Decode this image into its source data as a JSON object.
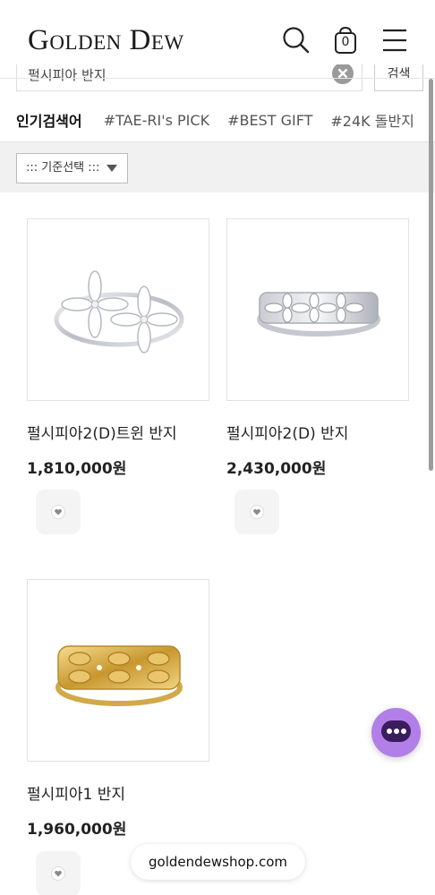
{
  "header": {
    "logo": "Golden Dew",
    "cart_count": "0",
    "icons": [
      "search-icon",
      "shopping-bag-icon",
      "hamburger-menu-icon"
    ]
  },
  "search": {
    "value": "펄시피아 반지",
    "button_label": "검색"
  },
  "keywords": {
    "title": "인기검색어",
    "items": [
      "#TAE-RI's PICK",
      "#BEST GIFT",
      "#24K 돌반지"
    ]
  },
  "sort": {
    "selected": "::: 기준선택 :::"
  },
  "products": [
    {
      "name": "펄시피아2(D)트윈 반지",
      "price": "1,810,000원",
      "metal": "silver"
    },
    {
      "name": "펄시피아2(D) 반지",
      "price": "2,430,000원",
      "metal": "silver"
    },
    {
      "name": "펄시피아1 반지",
      "price": "1,960,000원",
      "metal": "gold"
    }
  ],
  "footer": {
    "url": "goldendewshop.com"
  },
  "colors": {
    "chat_bubble": "#b27ee8",
    "chat_inner": "#3b1c5e",
    "gold": "#d9b45a",
    "silver": "#c9ccd2"
  }
}
